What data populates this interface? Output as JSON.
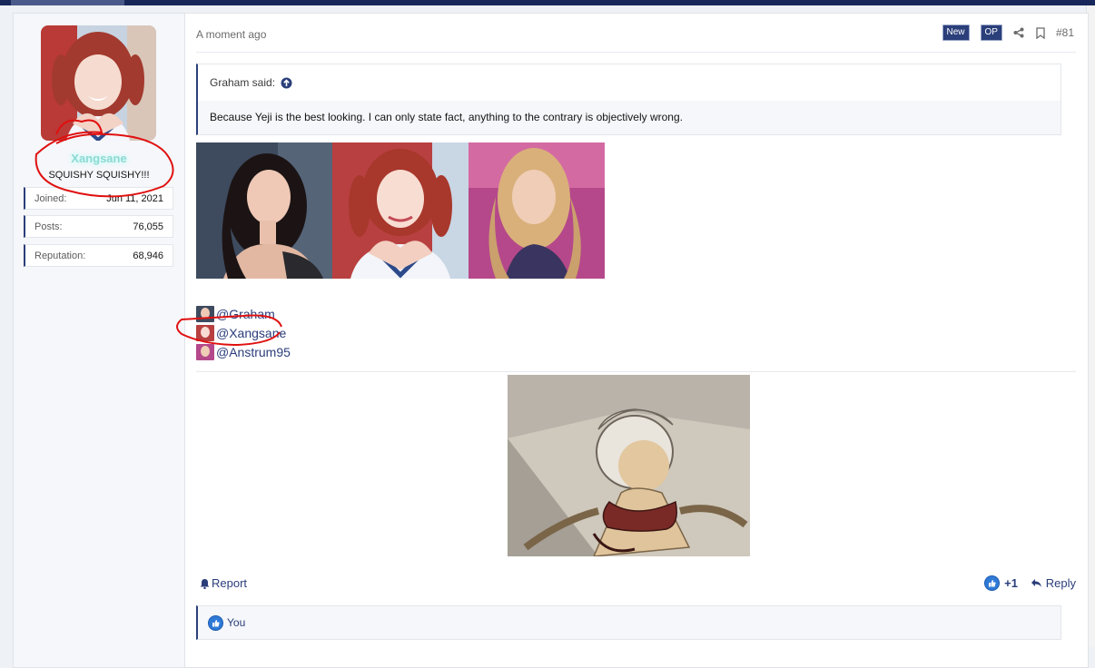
{
  "post": {
    "author": {
      "username": "Xangsane",
      "user_title": "SQUISHY SQUISHY!!!",
      "stats": [
        {
          "label": "Joined:",
          "value": "Jun 11, 2021"
        },
        {
          "label": "Posts:",
          "value": "76,055"
        },
        {
          "label": "Reputation:",
          "value": "68,946"
        }
      ]
    },
    "timestamp": "A moment ago",
    "badges": {
      "new": "New",
      "op": "OP"
    },
    "post_number": "#81",
    "quote": {
      "author_line": "Graham said:",
      "text": "Because Yeji is the best looking. I can only state fact, anything to the contrary is objectively wrong."
    },
    "mentions": [
      "@Graham",
      "@Xangsane",
      "@Anstrum95"
    ],
    "actions": {
      "report": "Report",
      "reaction_count": "+1",
      "reply": "Reply"
    },
    "reactions_summary": "You"
  },
  "colors": {
    "accent": "#2b3f7a",
    "username_glow": "#8fd8d2",
    "annotation": "#e01010",
    "like": "#2f7ad6"
  }
}
